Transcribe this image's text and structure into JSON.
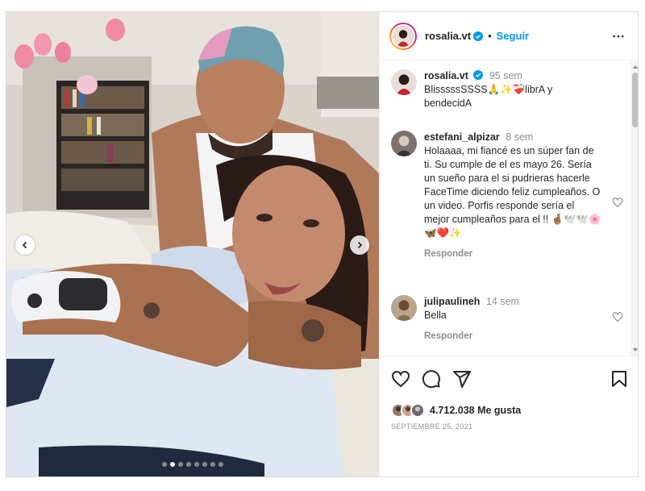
{
  "account": {
    "username": "rosalia.vt",
    "separator": "•",
    "follow_label": "Seguir"
  },
  "caption": {
    "username": "rosalia.vt",
    "time": "95 sem",
    "text": "BlisssssSSSS🙏✨❤️‍🩹librA y bendecidA"
  },
  "comments": [
    {
      "username": "estefani_alpizar",
      "time": "8 sem",
      "text": "Holaaaa, mi fiancé es un súper fan de ti. Su cumple de el es mayo 26. Sería un sueño para el si pudrieras hacerle FaceTime diciendo feliz cumpleaños. O un video. Porfis responde sería el mejor cumpleaños para el !! 🤞🏽🕊️🕊️🌸🦋❤️✨",
      "reply_label": "Responder"
    },
    {
      "username": "julipaulineh",
      "time": "14 sem",
      "text": "Bella",
      "reply_label": "Responder"
    }
  ],
  "stats": {
    "likes": "4.712.038 Me gusta",
    "date": "SEPTIEMBRE 25, 2021"
  },
  "carousel": {
    "total_slides": 8,
    "active_slide": 2
  },
  "icons": {
    "verified": "verified-badge-icon",
    "more": "more-options-icon",
    "like": "heart-icon",
    "comment": "comment-icon",
    "share": "share-icon",
    "save": "bookmark-icon"
  },
  "colors": {
    "follow": "#0095f6",
    "verified": "#0095f6",
    "muted": "#8e8e8e",
    "text": "#262626"
  }
}
